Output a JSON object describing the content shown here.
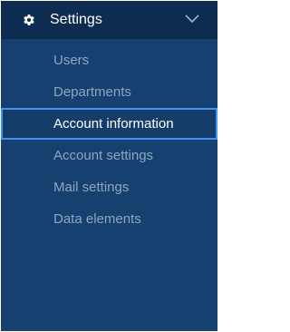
{
  "header": {
    "title": "Settings",
    "icon": "gear-icon",
    "chevron": "chevron-down-icon"
  },
  "menu": {
    "items": [
      {
        "label": "Users",
        "active": false
      },
      {
        "label": "Departments",
        "active": false
      },
      {
        "label": "Account information",
        "active": true
      },
      {
        "label": "Account settings",
        "active": false
      },
      {
        "label": "Mail settings",
        "active": false
      },
      {
        "label": "Data elements",
        "active": false
      }
    ]
  },
  "colors": {
    "panel_bg": "#15406f",
    "header_bg": "#0e2c50",
    "active_outline": "#3d97f0",
    "inactive_text": "#8fa6c0",
    "active_text": "#ffffff"
  }
}
